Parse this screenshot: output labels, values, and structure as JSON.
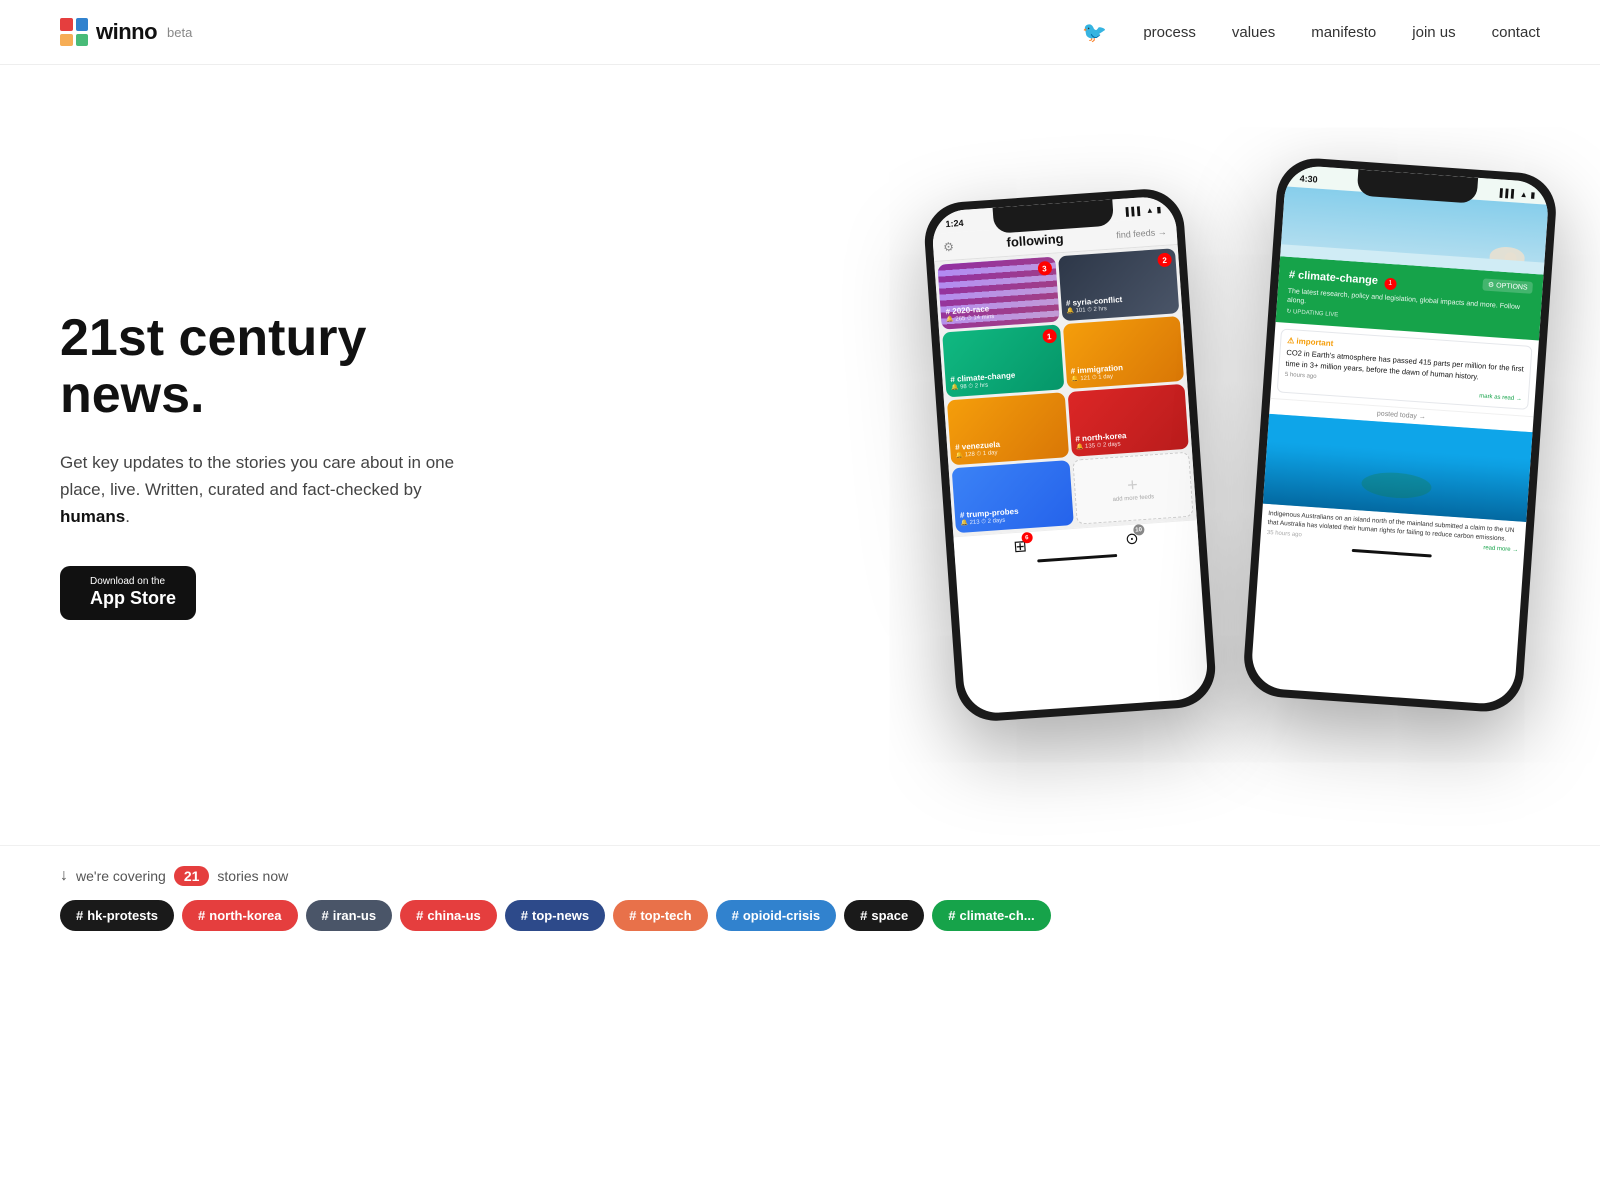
{
  "header": {
    "logo_text": "winno",
    "logo_beta": "beta",
    "nav_items": [
      "process",
      "values",
      "manifesto",
      "join us",
      "contact"
    ]
  },
  "hero": {
    "title": "21st century news.",
    "subtitle_start": "Get key updates to the stories you care about in one place, live. Written, curated and fact-checked by ",
    "subtitle_bold": "humans",
    "subtitle_end": ".",
    "app_store": {
      "line1": "Download on the",
      "line2": "App Store"
    }
  },
  "phone1": {
    "time": "1:24",
    "screen_title": "following",
    "find_feeds": "find feeds →",
    "feeds": [
      {
        "label": "# 2020-race",
        "meta": "265  14 mins",
        "badge": "3",
        "color": "bg-2020"
      },
      {
        "label": "# syria-conflict",
        "meta": "101  2 hrs",
        "badge": "2",
        "color": "war-bg"
      },
      {
        "label": "# climate-change",
        "meta": "98  2 hrs",
        "badge": "1",
        "color": "bg-climate"
      },
      {
        "label": "# immigration",
        "meta": "121  1 day",
        "badge": "",
        "color": "bg-immigration"
      },
      {
        "label": "# venezuela",
        "meta": "128  1 day",
        "badge": "",
        "color": "bg-venezuela"
      },
      {
        "label": "# north-korea",
        "meta": "135  2 days",
        "badge": "",
        "color": "bg-north-korea"
      },
      {
        "label": "# trump-probes",
        "meta": "213  2 days",
        "badge": "",
        "color": "bg-trump"
      },
      {
        "label": "add more feeds",
        "meta": "",
        "badge": "",
        "color": "bg-add"
      }
    ],
    "tab_badge": "6"
  },
  "phone2": {
    "time": "4:30",
    "tag": "# climate-change",
    "badge": "1",
    "options": "OPTIONS",
    "description": "The latest research, policy and legislation, global impacts and more. Follow along.",
    "updating": "UPDATING LIVE",
    "important_label": "important",
    "important_text": "CO2 in Earth's atmosphere has passed 415 parts per million for the first time in 3+ million years, before the dawn of human history.",
    "time_ago": "5 hours ago",
    "mark_read": "mark as read →",
    "posted_today": "posted today →",
    "island_caption": "Indigenous Australians on an island north of the mainland submitted a claim to the UN that Australia has violated their human rights for failing to reduce carbon emissions.",
    "island_time": "35 hours ago",
    "read_more": "read more →"
  },
  "covering": {
    "arrow": "↓",
    "text_before": "we're covering",
    "count": "21",
    "text_after": "stories now"
  },
  "tags": [
    {
      "label": "# hk-protests",
      "color": "dark"
    },
    {
      "label": "# north-korea",
      "color": "red"
    },
    {
      "label": "# iran-us",
      "color": "gray"
    },
    {
      "label": "# china-us",
      "color": "red"
    },
    {
      "label": "# top-news",
      "color": "navy"
    },
    {
      "label": "# top-tech",
      "color": "coral"
    },
    {
      "label": "# opioid-crisis",
      "color": "blue"
    },
    {
      "label": "# space",
      "color": "dark"
    },
    {
      "label": "# climate-ch...",
      "color": "green"
    }
  ]
}
